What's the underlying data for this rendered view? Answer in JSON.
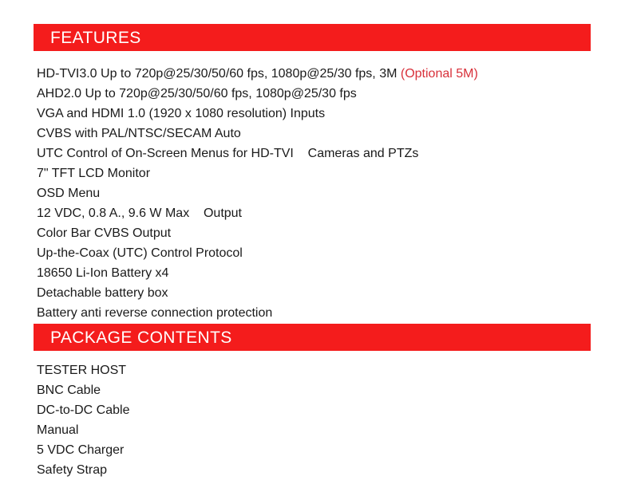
{
  "document": {
    "background_color": "#ffffff",
    "banner_color": "#f41c1c",
    "banner_text_color": "#ffffff",
    "body_text_color": "#1a1a1a",
    "accent_red_color": "#d8303a"
  },
  "sections": {
    "features": {
      "heading": "FEATURES",
      "items": [
        {
          "text": "HD-TVI3.0 Up to 720p@25/30/50/60 fps, 1080p@25/30 fps, 3M",
          "note": " (Optional 5M)"
        },
        {
          "text": "AHD2.0 Up to 720p@25/30/50/60 fps, 1080p@25/30 fps",
          "note": ""
        },
        {
          "text": "VGA and HDMI 1.0 (1920 x 1080 resolution) Inputs",
          "note": ""
        },
        {
          "text": "CVBS with PAL/NTSC/SECAM Auto",
          "note": ""
        },
        {
          "text": "UTC Control of On-Screen Menus for HD-TVI    Cameras and PTZs",
          "note": ""
        },
        {
          "text": "7\" TFT LCD Monitor",
          "note": ""
        },
        {
          "text": "OSD Menu",
          "note": ""
        },
        {
          "text": "12 VDC, 0.8 A., 9.6 W Max    Output",
          "note": ""
        },
        {
          "text": "Color Bar CVBS Output",
          "note": ""
        },
        {
          "text": "Up-the-Coax (UTC) Control Protocol",
          "note": ""
        },
        {
          "text": "18650 Li-Ion Battery x4",
          "note": ""
        },
        {
          "text": "Detachable battery box",
          "note": ""
        },
        {
          "text": "Battery anti reverse connection protection",
          "note": ""
        }
      ]
    },
    "package_contents": {
      "heading": "PACKAGE CONTENTS",
      "items": [
        {
          "text": "TESTER HOST",
          "note": ""
        },
        {
          "text": "BNC Cable",
          "note": ""
        },
        {
          "text": "DC-to-DC Cable",
          "note": ""
        },
        {
          "text": "Manual",
          "note": ""
        },
        {
          "text": "5 VDC Charger",
          "note": ""
        },
        {
          "text": "Safety Strap",
          "note": ""
        }
      ]
    }
  }
}
